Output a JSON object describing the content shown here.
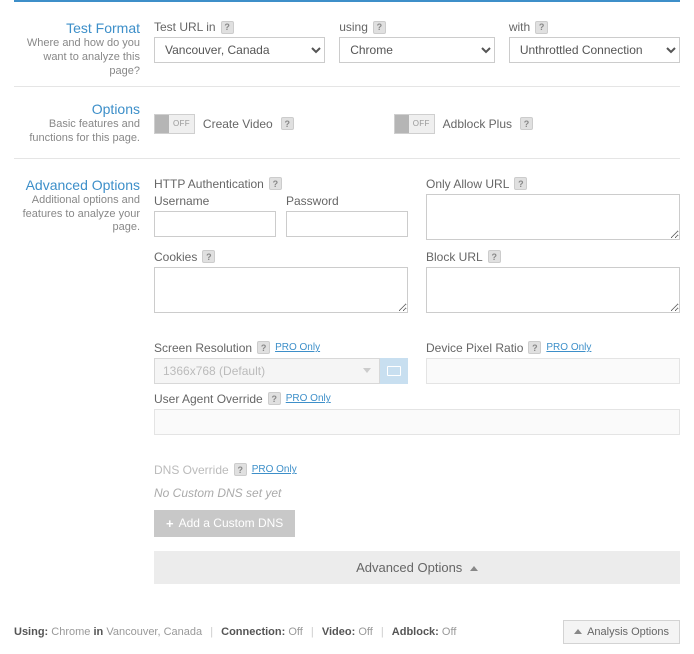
{
  "testFormat": {
    "title": "Test Format",
    "desc": "Where and how do you want to analyze this page?",
    "testUrlLabel": "Test URL in",
    "usingLabel": "using",
    "withLabel": "with",
    "locationValue": "Vancouver, Canada",
    "browserValue": "Chrome",
    "connectionValue": "Unthrottled Connection"
  },
  "options": {
    "title": "Options",
    "desc": "Basic features and functions for this page.",
    "toggleOff": "OFF",
    "createVideo": "Create Video",
    "adblock": "Adblock Plus"
  },
  "advanced": {
    "title": "Advanced Options",
    "desc": "Additional options and features to analyze your page.",
    "httpAuth": "HTTP Authentication",
    "username": "Username",
    "password": "Password",
    "onlyAllow": "Only Allow URL",
    "cookies": "Cookies",
    "blockUrl": "Block URL",
    "screenRes": "Screen Resolution",
    "screenResValue": "1366x768 (Default)",
    "devicePixel": "Device Pixel Ratio",
    "userAgent": "User Agent Override",
    "dnsOverride": "DNS Override",
    "dnsMsg": "No Custom DNS set yet",
    "addDns": "Add a Custom DNS",
    "proOnly": "PRO Only",
    "barLabel": "Advanced Options"
  },
  "footer": {
    "using": "Using:",
    "browser": "Chrome",
    "in": "in",
    "location": "Vancouver, Canada",
    "connection": "Connection:",
    "connectionVal": "Off",
    "video": "Video:",
    "videoVal": "Off",
    "adblock": "Adblock:",
    "adblockVal": "Off",
    "analysisBtn": "Analysis Options"
  }
}
